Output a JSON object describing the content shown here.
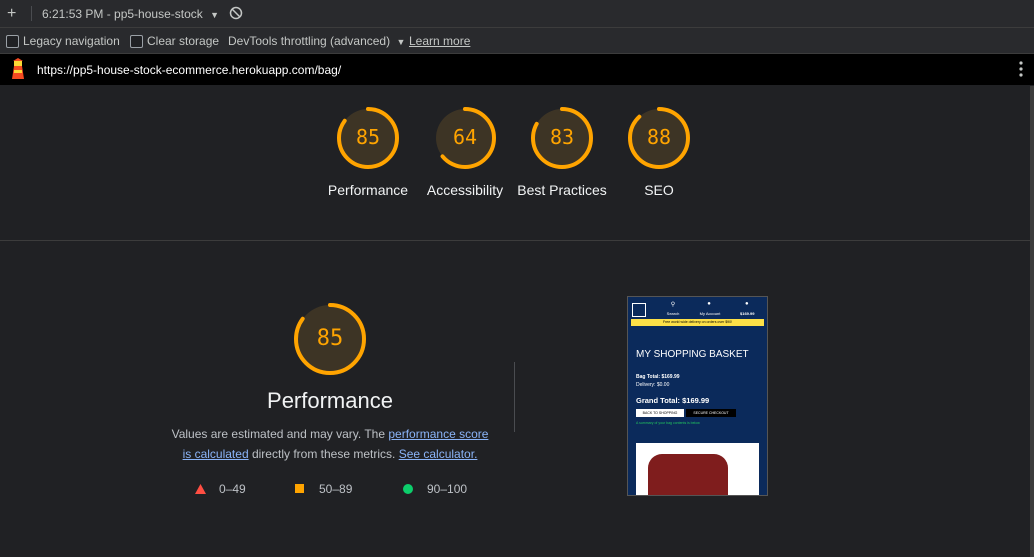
{
  "toolbar": {
    "time_label": "6:21:53 PM - pp5-house-stock",
    "legacy_navigation": "Legacy navigation",
    "clear_storage": "Clear storage",
    "throttling": "DevTools throttling (advanced)",
    "learn_more": "Learn more"
  },
  "url": "https://pp5-house-stock-ecommerce.herokuapp.com/bag/",
  "scores": [
    {
      "label": "Performance",
      "value": 85
    },
    {
      "label": "Accessibility",
      "value": 64
    },
    {
      "label": "Best Practices",
      "value": 83
    },
    {
      "label": "SEO",
      "value": 88
    }
  ],
  "performance": {
    "score": 85,
    "title": "Performance",
    "desc_part1": "Values are estimated and may vary. The",
    "link1_line1": "performance score",
    "link1_line2": "is calculated",
    "desc_part2": "directly from these metrics.",
    "link2": "See calculator."
  },
  "legend": [
    {
      "range": "0–49",
      "color": "#ff4e42",
      "shape": "triangle"
    },
    {
      "range": "50–89",
      "color": "#ffa400",
      "shape": "square"
    },
    {
      "range": "90–100",
      "color": "#0cce6b",
      "shape": "circle"
    }
  ],
  "colors": {
    "gauge": "#ffa400",
    "gauge_bg": "#3d3425"
  },
  "phone": {
    "search": "Search",
    "account": "My Account",
    "bag_total_top": "$169.99",
    "banner": "Free world wide delivery on orders over $90!",
    "heading": "MY SHOPPING BASKET",
    "bag_total": "Bag Total: $169.99",
    "delivery": "Delivery: $0.00",
    "grand_total": "Grand Total: $169.99",
    "back_btn": "BACK TO SHOPPING",
    "checkout_btn": "SECURE CHECKOUT",
    "summary": "A summary of your bag contents is below"
  }
}
